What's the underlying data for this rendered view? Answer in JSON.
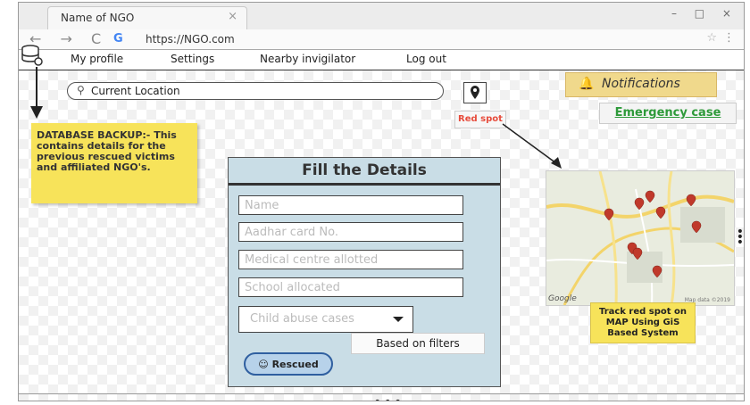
{
  "browser": {
    "tab_title": "Name of NGO",
    "tab_close": "×",
    "window_controls": "– □ ×",
    "nav_icons": "← → C",
    "google_icon": "G",
    "url": "https://NGO.com",
    "star": "☆",
    "kebab": "⋮"
  },
  "menu": {
    "items": [
      "My profile",
      "Settings",
      "Nearby invigilator",
      "Log out"
    ]
  },
  "search": {
    "icon": "search-icon",
    "value": "Current Location"
  },
  "pin_button": {
    "icon": "map-pin-icon"
  },
  "red_spot_label": "Red spot",
  "notifications": {
    "icon": "bell-icon",
    "label": "Notifications"
  },
  "emergency_link": "Emergency case",
  "database_note": "DATABASE BACKUP:- This contains details for the previous rescued victims and affiliated NGO's.",
  "form": {
    "title": "Fill the Details",
    "fields": [
      {
        "placeholder": "Name"
      },
      {
        "placeholder": "Aadhar card No."
      },
      {
        "placeholder": "Medical centre allotted"
      },
      {
        "placeholder": "School allocated"
      }
    ],
    "dropdown_label": "Child abuse cases",
    "filters_tooltip": "Based on filters",
    "rescued_button": "☺ Rescued"
  },
  "map": {
    "google_label": "Google",
    "attribution": "Map data ©2019",
    "note": "Track red spot on MAP Using GiS Based System"
  },
  "colors": {
    "accent_red": "#e74c3c",
    "accent_green": "#2e9a3a",
    "form_bg": "#c9dde6",
    "sticky_yellow": "#f7e35a",
    "notification_bg": "#f0d98c"
  }
}
